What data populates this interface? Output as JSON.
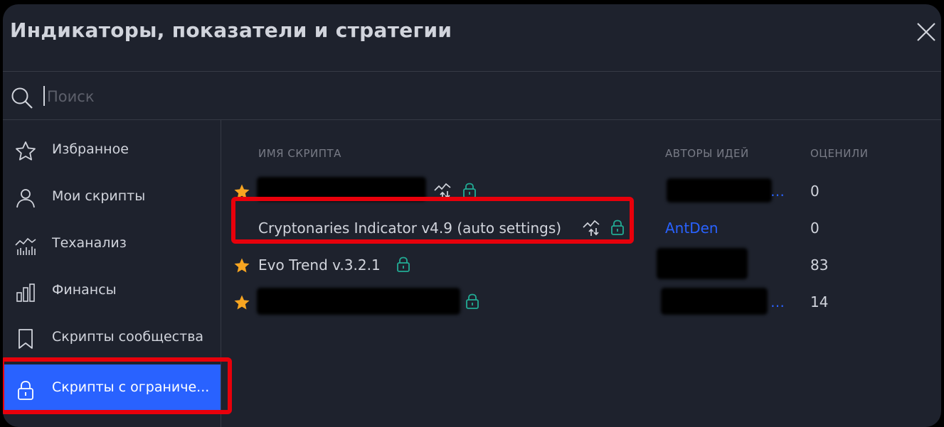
{
  "dialog": {
    "title": "Индикаторы, показатели и стратегии"
  },
  "search": {
    "placeholder": "Поиск"
  },
  "sidebar": {
    "items": [
      {
        "label": "Избранное",
        "icon": "star-outline-icon",
        "active": false
      },
      {
        "label": "Мои скрипты",
        "icon": "user-icon",
        "active": false
      },
      {
        "label": "Теханализ",
        "icon": "technical-analysis-icon",
        "active": false
      },
      {
        "label": "Финансы",
        "icon": "bar-chart-icon",
        "active": false
      },
      {
        "label": "Скрипты сообщества",
        "icon": "bookmark-icon",
        "active": false
      },
      {
        "label": "Скрипты с ограниче...",
        "icon": "lock-icon",
        "active": true
      }
    ]
  },
  "table": {
    "columns": {
      "name": "ИМЯ СКРИПТА",
      "authors": "АВТОРЫ ИДЕЙ",
      "rating": "ОЦЕНИЛИ"
    },
    "rows": [
      {
        "name": "",
        "author": "",
        "rating": "0",
        "favorite": true,
        "redacted": true
      },
      {
        "name": "Cryptonaries Indicator v4.9 (auto settings)",
        "author": "AntDen",
        "rating": "0",
        "favorite": false,
        "redacted": false
      },
      {
        "name": "Evo Trend v.3.2.1",
        "author": "",
        "rating": "83",
        "favorite": true,
        "redacted": false
      },
      {
        "name": "",
        "author": "",
        "rating": "14",
        "favorite": true,
        "redacted": true
      }
    ]
  },
  "colors": {
    "background": "#1e222d",
    "accent": "#2962ff",
    "star": "#f7a521",
    "lock": "#22ab94",
    "highlight": "#e8000b"
  }
}
